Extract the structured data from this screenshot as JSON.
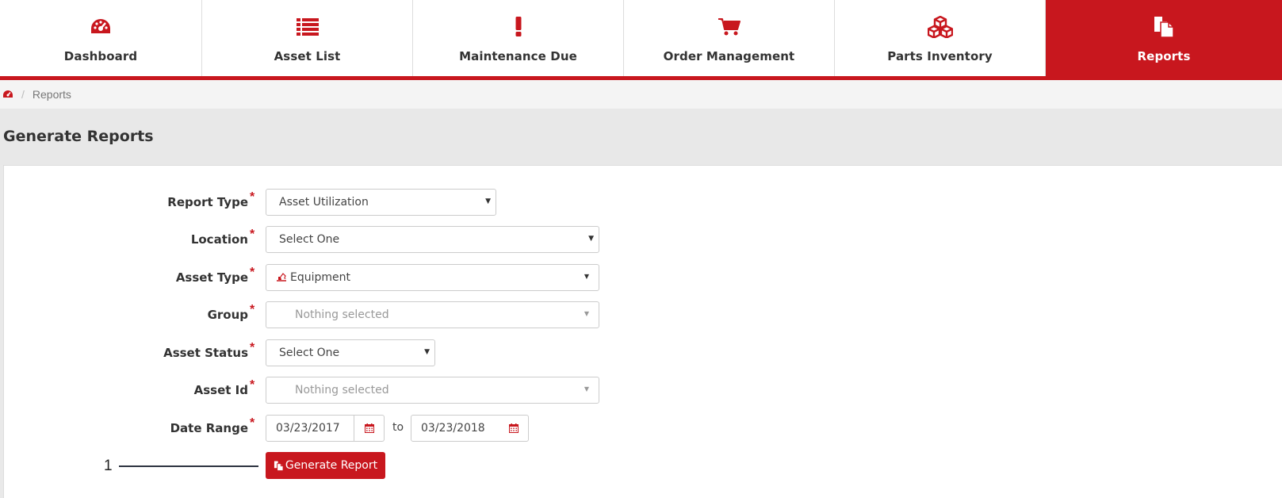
{
  "nav": {
    "items": [
      {
        "label": "Dashboard",
        "icon": "dashboard-gauge-icon"
      },
      {
        "label": "Asset List",
        "icon": "list-icon"
      },
      {
        "label": "Maintenance Due",
        "icon": "exclamation-icon"
      },
      {
        "label": "Order Management",
        "icon": "shopping-cart-icon"
      },
      {
        "label": "Parts Inventory",
        "icon": "cubes-icon"
      },
      {
        "label": "Reports",
        "icon": "copy-documents-icon",
        "active": true
      }
    ]
  },
  "breadcrumb": {
    "home_icon": "dashboard-gauge-icon",
    "separator": "/",
    "current": "Reports"
  },
  "page": {
    "title": "Generate Reports"
  },
  "form": {
    "required_mark": "*",
    "report_type": {
      "label": "Report Type",
      "value": "Asset Utilization"
    },
    "location": {
      "label": "Location",
      "value": "Select One"
    },
    "asset_type": {
      "label": "Asset Type",
      "value": "Equipment",
      "icon": "excavator-icon"
    },
    "group": {
      "label": "Group",
      "value": "Nothing selected"
    },
    "asset_status": {
      "label": "Asset Status",
      "value": "Select One"
    },
    "asset_id": {
      "label": "Asset Id",
      "value": "Nothing selected"
    },
    "date_range": {
      "label": "Date Range",
      "from": "03/23/2017",
      "to_text": "to",
      "to": "03/23/2018",
      "icon": "calendar-icon"
    },
    "generate_button": {
      "label": "Generate Report",
      "icon": "copy-documents-icon"
    }
  },
  "annotation": {
    "number": "1"
  },
  "colors": {
    "accent": "#c8171e",
    "panel": "#ffffff",
    "background": "#e9e9e9"
  }
}
